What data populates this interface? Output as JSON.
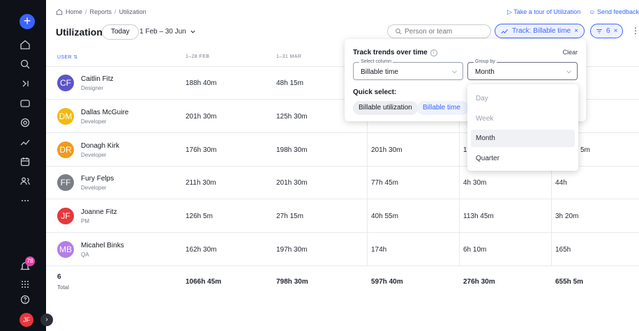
{
  "sidebar": {
    "add_label": "+",
    "notification_count": "78",
    "user_initials": "JF",
    "collapse_glyph": "›",
    "icons": [
      "home-icon",
      "search-icon",
      "chevron-right-icon",
      "folder-icon",
      "at-icon",
      "chart-icon",
      "calendar-icon",
      "people-icon",
      "more-icon",
      "bell-icon",
      "apps-grid-icon",
      "help-icon"
    ],
    "colors": {
      "background": "#0e1117",
      "accent": "#3b63ff",
      "badge": "#e63fa8"
    }
  },
  "breadcrumb": {
    "home": "Home",
    "reports": "Reports",
    "current": "Utilization",
    "sep": "/"
  },
  "top_links": {
    "tour": "▷ Take a tour of Utilization",
    "feedback": "☺ Send feedback"
  },
  "header": {
    "title": "Utilization",
    "today_label": "Today",
    "date_range": "1 Feb – 30 Jun",
    "search_placeholder": "Person or team",
    "track_chip": "Track: Billable time",
    "filter_count": "6",
    "more": "⋮"
  },
  "table": {
    "columns": [
      "USER",
      "1–28 FEB",
      "1–31 MAR"
    ],
    "rows": [
      {
        "initials": "CF",
        "name": "Caitlin Fitz",
        "role": "Designer",
        "color": "#5b55c9",
        "values": [
          "188h 40m",
          "48h 15m",
          "",
          "",
          ""
        ]
      },
      {
        "initials": "DM",
        "name": "Dallas McGuire",
        "role": "Developer",
        "color": "#f2b90f",
        "values": [
          "201h 30m",
          "125h 30m",
          "",
          "",
          ""
        ]
      },
      {
        "initials": "DR",
        "name": "Donagh Kirk",
        "role": "Developer",
        "color": "#f29a1a",
        "values": [
          "176h 30m",
          "198h 30m",
          "201h 30m",
          "1(",
          "5m"
        ]
      },
      {
        "initials": "FF",
        "name": "Fury Felps",
        "role": "Developer",
        "color": "#7a7f87",
        "values": [
          "211h 30m",
          "201h 30m",
          "77h 45m",
          "4h 30m",
          "44h"
        ]
      },
      {
        "initials": "JF",
        "name": "Joanne Fitz",
        "role": "PM",
        "color": "#e6373d",
        "values": [
          "126h 5m",
          "27h 15m",
          "40h 55m",
          "113h 45m",
          "3h 20m"
        ]
      },
      {
        "initials": "MB",
        "name": "Micahel Binks",
        "role": "QA",
        "color": "#b47de8",
        "values": [
          "162h 30m",
          "197h 30m",
          "174h",
          "6h 10m",
          "165h"
        ]
      }
    ],
    "total": {
      "count": "6",
      "label": "Total",
      "values": [
        "1066h 45m",
        "798h 30m",
        "597h 40m",
        "276h 30m",
        "655h 5m"
      ]
    }
  },
  "popover": {
    "title": "Track trends over time",
    "info": "i",
    "clear": "Clear",
    "select_column_label": "Select column",
    "select_column_value": "Billable time",
    "group_by_label": "Group by",
    "group_by_value": "Month",
    "quick_select_title": "Quick select:",
    "quick_chips": [
      "Billable utilization",
      "Billable time"
    ]
  },
  "dropdown": {
    "options": [
      "Day",
      "Week",
      "Month",
      "Quarter"
    ],
    "selected": "Month"
  }
}
